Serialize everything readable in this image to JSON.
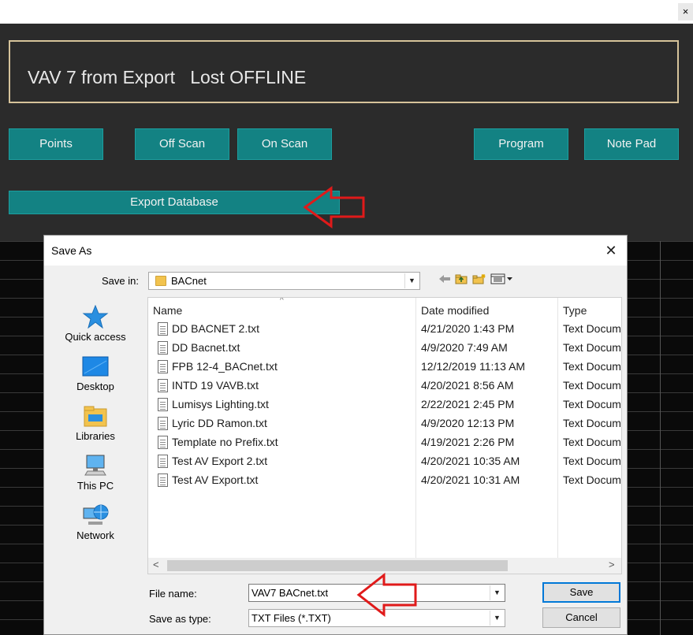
{
  "app": {
    "title": "VAV 7 from Export   Lost OFFLINE",
    "close_glyph": "×",
    "buttons": {
      "points": "Points",
      "off_scan": "Off Scan",
      "on_scan": "On Scan",
      "program": "Program",
      "note_pad": "Note Pad",
      "export_database": "Export Database"
    },
    "colors": {
      "panel": "#2b2b2b",
      "teal": "#138283",
      "title_border": "#d6c39a",
      "annotation_arrow": "#e01a1a"
    }
  },
  "dialog": {
    "title": "Save As",
    "close_glyph": "✕",
    "save_in_label": "Save in:",
    "save_in_value": "BACnet",
    "toolbar_icons": [
      "back-arrow-icon",
      "up-folder-icon",
      "new-folder-icon",
      "view-menu-icon"
    ],
    "places": [
      {
        "label": "Quick access",
        "icon": "star-icon"
      },
      {
        "label": "Desktop",
        "icon": "desktop-icon"
      },
      {
        "label": "Libraries",
        "icon": "libraries-icon"
      },
      {
        "label": "This PC",
        "icon": "computer-icon"
      },
      {
        "label": "Network",
        "icon": "network-icon"
      }
    ],
    "columns": {
      "name": "Name",
      "date": "Date modified",
      "type": "Type"
    },
    "files": [
      {
        "name": "DD BACNET 2.txt",
        "date": "4/21/2020 1:43 PM",
        "type": "Text Document"
      },
      {
        "name": "DD Bacnet.txt",
        "date": "4/9/2020 7:49 AM",
        "type": "Text Document"
      },
      {
        "name": "FPB 12-4_BACnet.txt",
        "date": "12/12/2019 11:13 AM",
        "type": "Text Document"
      },
      {
        "name": "INTD 19 VAVB.txt",
        "date": "4/20/2021 8:56 AM",
        "type": "Text Document"
      },
      {
        "name": "Lumisys Lighting.txt",
        "date": "2/22/2021 2:45 PM",
        "type": "Text Document"
      },
      {
        "name": "Lyric DD Ramon.txt",
        "date": "4/9/2020 12:13 PM",
        "type": "Text Document"
      },
      {
        "name": "Template no Prefix.txt",
        "date": "4/19/2021 2:26 PM",
        "type": "Text Document"
      },
      {
        "name": "Test AV Export 2.txt",
        "date": "4/20/2021 10:35 AM",
        "type": "Text Document"
      },
      {
        "name": "Test AV Export.txt",
        "date": "4/20/2021 10:31 AM",
        "type": "Text Document"
      }
    ],
    "file_name_label": "File name:",
    "file_name_value": "VAV7 BACnet.txt",
    "save_type_label": "Save as type:",
    "save_type_value": "TXT Files (*.TXT)",
    "save_button": "Save",
    "cancel_button": "Cancel"
  }
}
